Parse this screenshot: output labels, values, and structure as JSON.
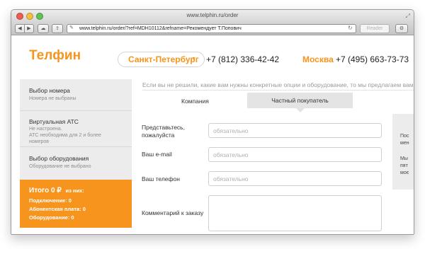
{
  "window": {
    "title": "www.telphin.ru/order",
    "address": "www.telphin.ru/order/?ref=MDH10112&refname=Рекомендует Т.Попович",
    "reader_label": "Reader"
  },
  "header": {
    "logo": "Телфин",
    "city": "Санкт-Петербург",
    "phone": "+7 (812) 336-42-42",
    "moscow_label": "Москва",
    "moscow_phone": "+7 (495) 663-73-73"
  },
  "sidebar": {
    "items": [
      {
        "title": "Выбор номера",
        "subtitle": [
          "Номера не выбраны"
        ]
      },
      {
        "title": "Виртуальная АТС",
        "subtitle": [
          "Не настроена.",
          "АТС необходима для 2 и более",
          "номеров"
        ]
      },
      {
        "title": "Выбор оборудования",
        "subtitle": [
          "Оборудование не выбрано"
        ]
      }
    ],
    "total": {
      "label": "Итого",
      "amount": "0",
      "currency": "₽",
      "suffix": "из них:",
      "connection": "Подключение: 0",
      "subscription": "Абонентская плата: 0",
      "equipment": "Оборудование: 0"
    }
  },
  "main": {
    "hint": "Если вы не решили, какие вам нужны конкретные опции и оборудование, то мы предлагаем вам з",
    "tabs": [
      {
        "label": "Компания"
      },
      {
        "label": "Частный покупатель"
      }
    ],
    "form": {
      "name_label_1": "Представьтесь,",
      "name_label_2": "пожалуйста",
      "email_label": "Ваш e-mail",
      "phone_label": "Ваш телефон",
      "comment_label": "Комментарий к заказу",
      "placeholder": "обязательно"
    },
    "side_panel": [
      "Пос",
      "мен",
      "Мы",
      "пят",
      "моє"
    ]
  },
  "colors": {
    "accent": "#f7941d",
    "sidebar_bg": "#ececec"
  }
}
